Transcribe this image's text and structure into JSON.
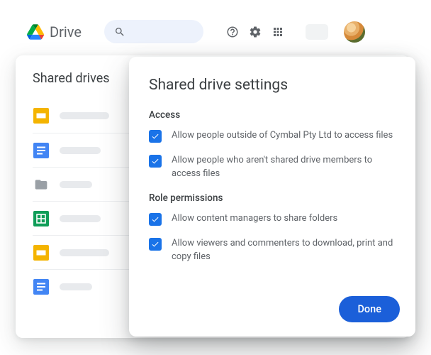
{
  "brand": "Drive",
  "panel": {
    "title": "Shared drives"
  },
  "dialog": {
    "title": "Shared drive settings",
    "sections": {
      "access": {
        "heading": "Access",
        "opts": [
          "Allow people outside of Cymbal Pty Ltd to access files",
          "Allow people who aren't shared drive members to access files"
        ]
      },
      "roles": {
        "heading": "Role permissions",
        "opts": [
          "Allow content managers to share folders",
          "Allow viewers and commenters to download, print and copy files"
        ]
      }
    },
    "done": "Done"
  }
}
